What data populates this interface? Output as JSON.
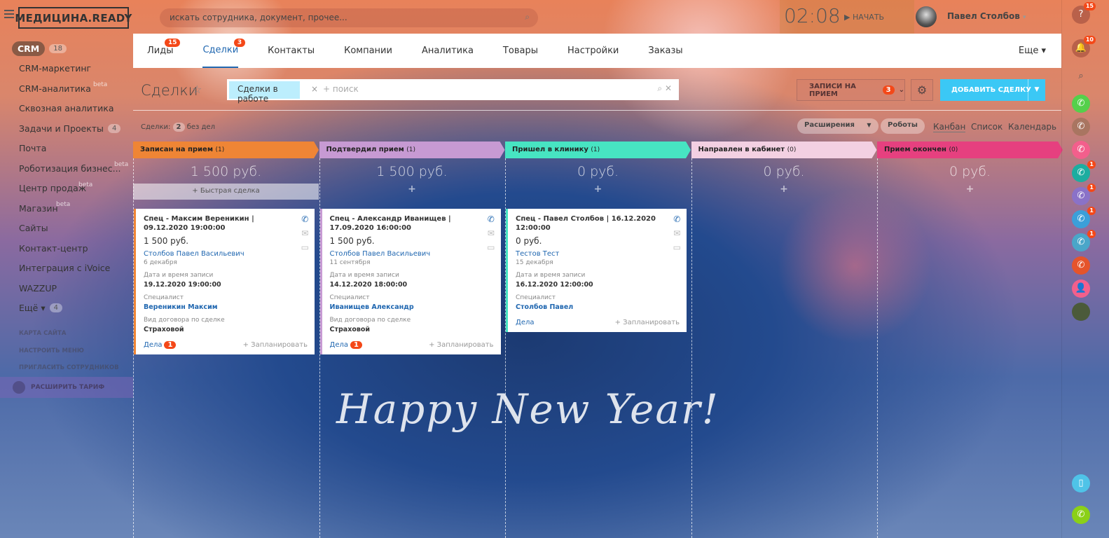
{
  "header": {
    "logo": "МЕДИЦИНА.READY",
    "search_placeholder": "искать сотрудника, документ, прочее...",
    "time": "02:08",
    "start_label": "НАЧАТЬ",
    "user_name": "Павел Столбов"
  },
  "sidebar": {
    "items": [
      {
        "label": "CRM",
        "count": "18"
      },
      {
        "label": "CRM-маркетинг"
      },
      {
        "label": "CRM-аналитика",
        "beta": "beta"
      },
      {
        "label": "Сквозная аналитика"
      },
      {
        "label": "Задачи и Проекты",
        "count": "4"
      },
      {
        "label": "Почта"
      },
      {
        "label": "Роботизация бизнес...",
        "beta": "beta"
      },
      {
        "label": "Центр продаж",
        "beta": "beta"
      },
      {
        "label": "Магазин",
        "beta": "beta"
      },
      {
        "label": "Сайты"
      },
      {
        "label": "Контакт-центр"
      },
      {
        "label": "Интеграция с iVoice"
      },
      {
        "label": "WAZZUP"
      },
      {
        "label": "Ещё ▾",
        "count": "4"
      }
    ],
    "links": [
      "КАРТА САЙТА",
      "НАСТРОИТЬ МЕНЮ",
      "ПРИГЛАСИТЬ СОТРУДНИКОВ"
    ],
    "tariff": "РАСШИРИТЬ ТАРИФ"
  },
  "tabs": {
    "items": [
      {
        "label": "Лиды",
        "badge": "15"
      },
      {
        "label": "Сделки",
        "badge": "3",
        "active": true
      },
      {
        "label": "Контакты"
      },
      {
        "label": "Компании"
      },
      {
        "label": "Аналитика"
      },
      {
        "label": "Товары"
      },
      {
        "label": "Настройки"
      },
      {
        "label": "Заказы"
      }
    ],
    "more": "Еще ▾"
  },
  "toolbar": {
    "title": "Сделки",
    "filter_chip": "Сделки в работе",
    "search_placeholder": "+ поиск",
    "appointments_label": "ЗАПИСИ НА ПРИЕМ",
    "appointments_badge": "3",
    "add_label": "ДОБАВИТЬ СДЕЛКУ"
  },
  "summary": {
    "label": "Сделки:",
    "count": "2",
    "suffix": "без дел"
  },
  "views": {
    "extensions": "Расширения",
    "robots": "Роботы",
    "kanban": "Канбан",
    "list": "Список",
    "calendar": "Календарь"
  },
  "quick_deal": "Быстрая сделка",
  "columns": [
    {
      "title": "Записан на прием",
      "count": "(1)",
      "sum": "1 500 руб.",
      "color": "#ef8535",
      "cards": [
        {
          "title": "Спец - Максим Вереникин | 09.12.2020 19:00:00",
          "sum": "1 500 руб.",
          "client": "Столбов Павел Васильевич",
          "date": "6 декабря",
          "fields": [
            {
              "label": "Дата и время записи",
              "value": "19.12.2020 19:00:00"
            },
            {
              "label": "Специалист",
              "value": "Вереникин Максим",
              "link": true
            },
            {
              "label": "Вид договора по сделке",
              "value": "Страховой"
            }
          ],
          "tasks": "Дела",
          "tasks_count": "1",
          "plan": "+ Запланировать"
        }
      ]
    },
    {
      "title": "Подтвердил прием",
      "count": "(1)",
      "sum": "1 500 руб.",
      "color": "#c79ad3",
      "cards": [
        {
          "title": "Спец - Александр Иванищев | 17.09.2020 16:00:00",
          "sum": "1 500 руб.",
          "client": "Столбов Павел Васильевич",
          "date": "11 сентября",
          "fields": [
            {
              "label": "Дата и время записи",
              "value": "14.12.2020 18:00:00"
            },
            {
              "label": "Специалист",
              "value": "Иванищев Александр",
              "link": true
            },
            {
              "label": "Вид договора по сделке",
              "value": "Страховой"
            }
          ],
          "tasks": "Дела",
          "tasks_count": "1",
          "plan": "+ Запланировать"
        }
      ]
    },
    {
      "title": "Пришел в клинику",
      "count": "(1)",
      "sum": "0 руб.",
      "color": "#47e4c2",
      "cards": [
        {
          "title": "Спец - Павел Столбов | 16.12.2020 12:00:00",
          "sum": "0 руб.",
          "client": "Тестов Тест",
          "date": "15 декабря",
          "fields": [
            {
              "label": "Дата и время записи",
              "value": "16.12.2020 12:00:00"
            },
            {
              "label": "Специалист",
              "value": "Столбов Павел",
              "link": true
            }
          ],
          "tasks": "Дела",
          "plan": "+ Запланировать"
        }
      ]
    },
    {
      "title": "Направлен в кабинет",
      "count": "(0)",
      "sum": "0 руб.",
      "color": "#f3d0e2",
      "cards": []
    },
    {
      "title": "Прием окончен",
      "count": "(0)",
      "sum": "0 руб.",
      "color": "#e6407f",
      "cards": []
    }
  ],
  "right_bar": [
    {
      "icon": "help-icon",
      "color": "#b9614a",
      "badge": "15"
    },
    {
      "icon": "bell-icon",
      "color": "#b9614a",
      "badge": "10"
    },
    {
      "icon": "search-icon",
      "color": "transparent"
    },
    {
      "icon": "phone-icon",
      "color": "#55d04b"
    },
    {
      "icon": "phone-icon",
      "color": "#a97561"
    },
    {
      "icon": "phone-icon",
      "color": "#f35f8c"
    },
    {
      "icon": "phone-icon",
      "color": "#1dada0",
      "badge": "1"
    },
    {
      "icon": "phone-icon",
      "color": "#8a72c8",
      "badge": "1"
    },
    {
      "icon": "phone-icon",
      "color": "#3b9fd9",
      "badge": "1"
    },
    {
      "icon": "phone-icon",
      "color": "#4aa6c9",
      "badge": "1"
    },
    {
      "icon": "phone-icon",
      "color": "#e5542b"
    },
    {
      "icon": "user-icon",
      "color": "#f35f8c"
    },
    {
      "icon": "avatar-icon",
      "color": "#4b5a3a"
    },
    {
      "icon": "mobile-icon",
      "color": "#4fc3e8"
    },
    {
      "icon": "phone-icon",
      "color": "#8bd017"
    }
  ],
  "background": {
    "text": "Happy New Year!"
  }
}
